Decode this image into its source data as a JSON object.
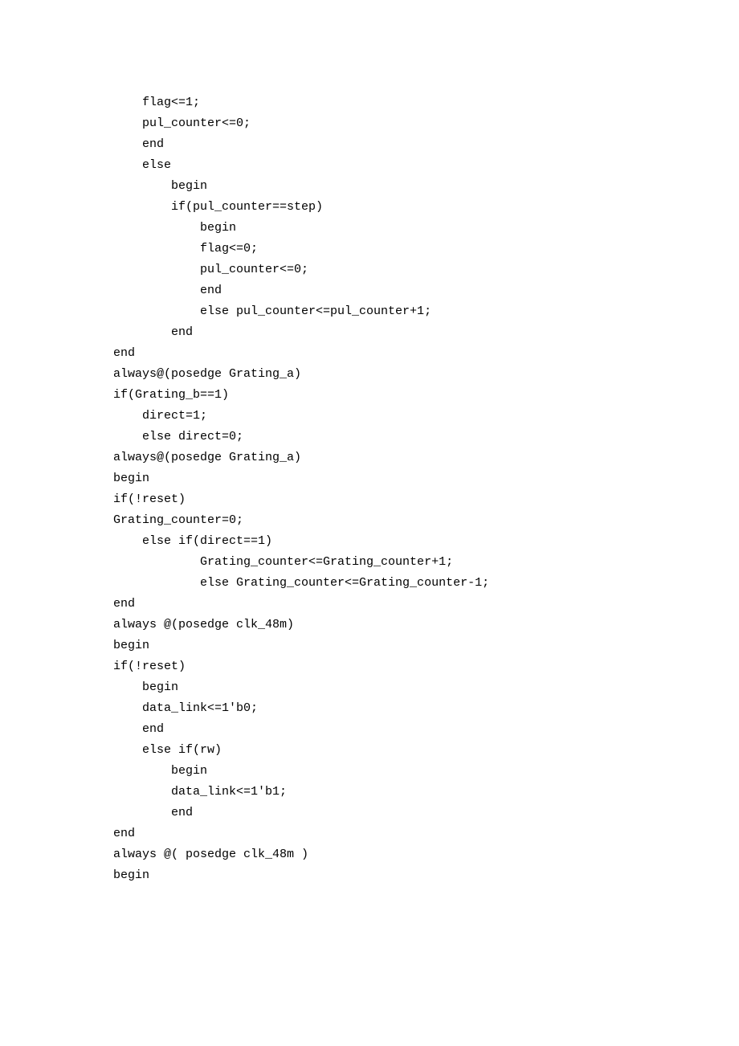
{
  "code": {
    "lines": [
      "    flag<=1;",
      "    pul_counter<=0;",
      "    end",
      "    else",
      "        begin",
      "        if(pul_counter==step)",
      "            begin",
      "            flag<=0;",
      "            pul_counter<=0;",
      "            end",
      "            else pul_counter<=pul_counter+1;",
      "        end",
      "end",
      "",
      "always@(posedge Grating_a)",
      "if(Grating_b==1)",
      "    direct=1;",
      "    else direct=0;",
      "",
      "always@(posedge Grating_a)",
      "begin",
      "if(!reset)",
      "Grating_counter=0;",
      "    else if(direct==1)",
      "            Grating_counter<=Grating_counter+1;",
      "            else Grating_counter<=Grating_counter-1;",
      "",
      "end",
      "",
      "always @(posedge clk_48m)",
      "begin",
      "if(!reset)",
      "    begin",
      "    data_link<=1'b0;",
      "    end",
      "    else if(rw)",
      "        begin",
      "        data_link<=1'b1;",
      "        end",
      "",
      "end",
      "",
      "always @( posedge clk_48m )",
      "begin"
    ]
  }
}
